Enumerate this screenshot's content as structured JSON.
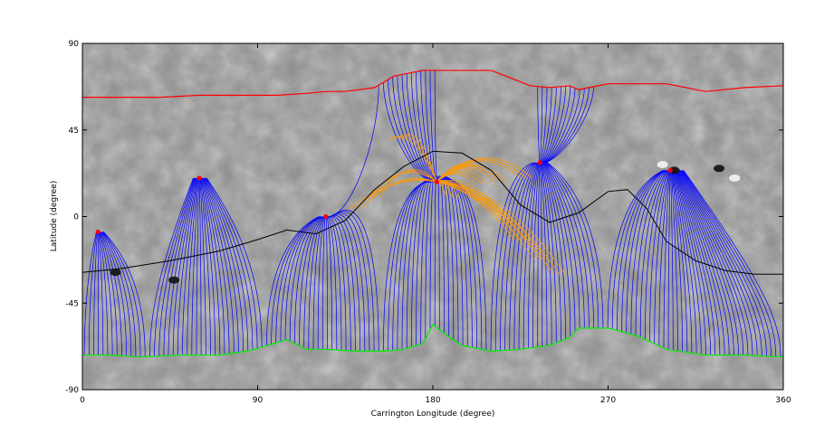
{
  "chart_data": {
    "type": "map",
    "title": "",
    "xlabel": "Carrington Longitude (degree)",
    "ylabel": "Latitude (degree)",
    "xlim": [
      0,
      360
    ],
    "ylim": [
      -90,
      90
    ],
    "xticks": [
      0,
      90,
      180,
      270,
      360
    ],
    "yticks": [
      90,
      45,
      0,
      -45,
      -90
    ],
    "colors": {
      "negative_boundary": "#ff0000",
      "positive_boundary": "#00ee00",
      "open_field_lines": "#0000ff",
      "closed_field_lines": "#ff9900",
      "neutral_line": "#000000",
      "background": "#8c8c8c"
    },
    "neutral_line": {
      "x": [
        0,
        20,
        45,
        70,
        90,
        105,
        120,
        135,
        150,
        165,
        180,
        195,
        210,
        225,
        240,
        255,
        270,
        280,
        290,
        300,
        315,
        330,
        345,
        360
      ],
      "y": [
        -29,
        -27,
        -23,
        -18,
        -12,
        -7,
        -9,
        -2,
        14,
        26,
        34,
        33,
        24,
        6,
        -3,
        2,
        13,
        14,
        4,
        -13,
        -23,
        -28,
        -30,
        -30
      ]
    },
    "red_boundary": {
      "x": [
        0,
        20,
        40,
        60,
        80,
        100,
        115,
        125,
        135,
        150,
        160,
        175,
        190,
        210,
        220,
        230,
        240,
        250,
        255,
        260,
        270,
        290,
        300,
        310,
        320,
        340,
        360
      ],
      "y": [
        62,
        62,
        62,
        63,
        63,
        63,
        64,
        65,
        65,
        67,
        73,
        76,
        76,
        76,
        72,
        68,
        67,
        68,
        66,
        67,
        69,
        69,
        69,
        67,
        65,
        67,
        68
      ]
    },
    "green_boundary": {
      "x": [
        0,
        15,
        30,
        50,
        70,
        85,
        95,
        105,
        115,
        125,
        140,
        155,
        165,
        175,
        180,
        185,
        195,
        210,
        225,
        240,
        250,
        255,
        270,
        285,
        300,
        320,
        340,
        360
      ],
      "y": [
        -72,
        -72,
        -73,
        -72,
        -72,
        -70,
        -67,
        -64,
        -69,
        -69,
        -70,
        -70,
        -69,
        -66,
        -56,
        -60,
        -67,
        -70,
        -69,
        -67,
        -63,
        -58,
        -58,
        -62,
        -69,
        -72,
        -72,
        -73
      ]
    },
    "open_field_origins": [
      {
        "x": 60,
        "y": 20
      },
      {
        "x": 125,
        "y": 0
      },
      {
        "x": 182,
        "y": 18
      },
      {
        "x": 235,
        "y": 28
      },
      {
        "x": 302,
        "y": 24
      },
      {
        "x": 8,
        "y": -8
      }
    ],
    "closed_loops": [
      {
        "x1": 182,
        "y1": 18,
        "x2": 205,
        "y2": 17,
        "height": 22
      },
      {
        "x1": 182,
        "y1": 18,
        "x2": 215,
        "y2": 18,
        "height": 34
      },
      {
        "x1": 182,
        "y1": 18,
        "x2": 228,
        "y2": 20,
        "height": 46
      },
      {
        "x1": 182,
        "y1": 18,
        "x2": 200,
        "y2": 26,
        "height": 14
      },
      {
        "x1": 182,
        "y1": 18,
        "x2": 150,
        "y2": 10,
        "height": 40
      },
      {
        "x1": 182,
        "y1": 18,
        "x2": 140,
        "y2": 4,
        "height": 26
      },
      {
        "x1": 182,
        "y1": 18,
        "x2": 160,
        "y2": 40,
        "height": 44
      },
      {
        "x1": 182,
        "y1": 18,
        "x2": 210,
        "y2": 5,
        "height": 18
      },
      {
        "x1": 182,
        "y1": 18,
        "x2": 235,
        "y2": -22,
        "height": 36
      },
      {
        "x1": 182,
        "y1": 18,
        "x2": 245,
        "y2": -30,
        "height": 48
      },
      {
        "x1": 182,
        "y1": 18,
        "x2": 225,
        "y2": -12,
        "height": 26
      },
      {
        "x1": 182,
        "y1": 18,
        "x2": 190,
        "y2": 10,
        "height": 10
      }
    ],
    "sunspots": [
      {
        "x": 17,
        "y": -29,
        "polarity": "negative"
      },
      {
        "x": 47,
        "y": -33,
        "polarity": "negative"
      },
      {
        "x": 298,
        "y": 27,
        "polarity": "positive"
      },
      {
        "x": 304,
        "y": 24,
        "polarity": "negative"
      },
      {
        "x": 327,
        "y": 25,
        "polarity": "negative"
      },
      {
        "x": 335,
        "y": 20,
        "polarity": "positive"
      }
    ]
  }
}
